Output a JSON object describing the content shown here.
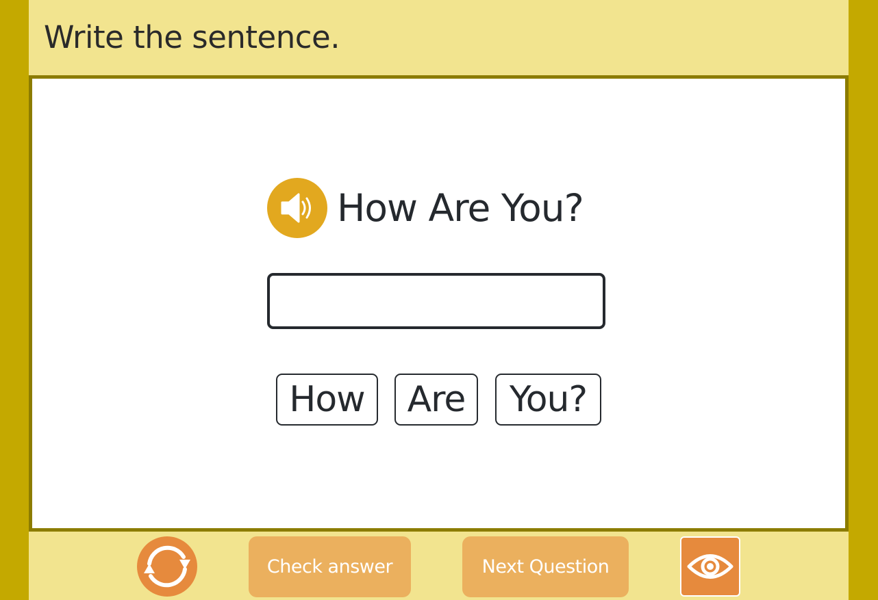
{
  "header": {
    "instruction": "Write the sentence."
  },
  "prompt": {
    "audio_icon": "speaker-icon",
    "text": "How Are You?"
  },
  "answer": {
    "value": "",
    "placeholder": ""
  },
  "word_bank": [
    {
      "label": "How"
    },
    {
      "label": "Are"
    },
    {
      "label": "You?"
    }
  ],
  "footer": {
    "reset_icon": "refresh-icon",
    "check_label": "Check answer",
    "next_label": "Next Question",
    "reveal_icon": "eye-icon"
  },
  "colors": {
    "outer_background": "#c4a900",
    "panel_background": "#f2e48f",
    "panel_border": "#8c7c00",
    "audio_button": "#e2a81f",
    "orange_icon_button": "#e68a3d",
    "action_button": "#ebb05e",
    "text": "#25292e"
  }
}
